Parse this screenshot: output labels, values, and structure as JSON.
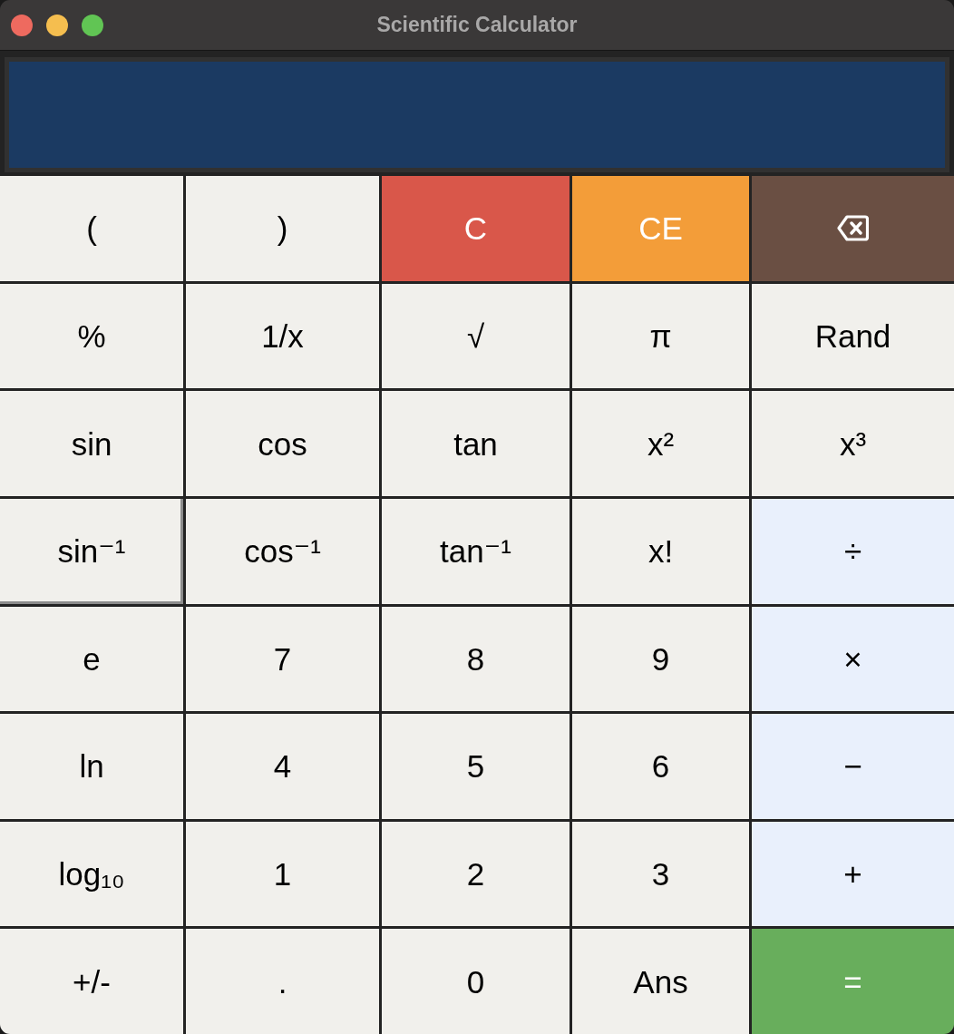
{
  "window": {
    "title": "Scientific Calculator",
    "controls": [
      {
        "kind": "close"
      },
      {
        "kind": "minimize"
      },
      {
        "kind": "zoom"
      }
    ]
  },
  "keypad": {
    "rows": [
      [
        {
          "label": "(",
          "kind": "key",
          "focused": false
        },
        {
          "label": ")",
          "kind": "key",
          "focused": false
        },
        {
          "label": "C",
          "kind": "clear",
          "focused": false
        },
        {
          "label": "CE",
          "kind": "clear_entry",
          "focused": false
        },
        {
          "kind": "backspace",
          "focused": false
        }
      ],
      [
        {
          "label": "%",
          "kind": "key",
          "focused": false
        },
        {
          "label": "1/x",
          "kind": "key",
          "focused": false
        },
        {
          "label": "√",
          "kind": "key",
          "focused": false
        },
        {
          "label": "π",
          "kind": "key",
          "focused": false
        },
        {
          "label": "Rand",
          "kind": "key",
          "focused": false
        }
      ],
      [
        {
          "label": "sin",
          "kind": "key",
          "focused": false
        },
        {
          "label": "cos",
          "kind": "key",
          "focused": false
        },
        {
          "label": "tan",
          "kind": "key",
          "focused": false
        },
        {
          "label": "x²",
          "kind": "key",
          "focused": false
        },
        {
          "label": "x³",
          "kind": "key",
          "focused": false
        }
      ],
      [
        {
          "label": "sin⁻¹",
          "kind": "key",
          "focused": true
        },
        {
          "label": "cos⁻¹",
          "kind": "key",
          "focused": false
        },
        {
          "label": "tan⁻¹",
          "kind": "key",
          "focused": false
        },
        {
          "label": "x!",
          "kind": "key",
          "focused": false
        },
        {
          "label": "÷",
          "kind": "operator",
          "focused": false
        }
      ],
      [
        {
          "label": "e",
          "kind": "key",
          "focused": false
        },
        {
          "label": "7",
          "kind": "key",
          "focused": false
        },
        {
          "label": "8",
          "kind": "key",
          "focused": false
        },
        {
          "label": "9",
          "kind": "key",
          "focused": false
        },
        {
          "label": "×",
          "kind": "operator",
          "focused": false
        }
      ],
      [
        {
          "label": "ln",
          "kind": "key",
          "focused": false
        },
        {
          "label": "4",
          "kind": "key",
          "focused": false
        },
        {
          "label": "5",
          "kind": "key",
          "focused": false
        },
        {
          "label": "6",
          "kind": "key",
          "focused": false
        },
        {
          "label": "−",
          "kind": "operator",
          "focused": false
        }
      ],
      [
        {
          "label": "log₁₀",
          "kind": "key",
          "focused": false
        },
        {
          "label": "1",
          "kind": "key",
          "focused": false
        },
        {
          "label": "2",
          "kind": "key",
          "focused": false
        },
        {
          "label": "3",
          "kind": "key",
          "focused": false
        },
        {
          "label": "+",
          "kind": "operator",
          "focused": false
        }
      ],
      [
        {
          "label": "+/-",
          "kind": "key",
          "focused": false
        },
        {
          "label": ".",
          "kind": "key",
          "focused": false
        },
        {
          "label": "0",
          "kind": "key",
          "focused": false
        },
        {
          "label": "Ans",
          "kind": "key",
          "focused": false
        },
        {
          "label": "=",
          "kind": "equals",
          "focused": false
        }
      ]
    ]
  }
}
